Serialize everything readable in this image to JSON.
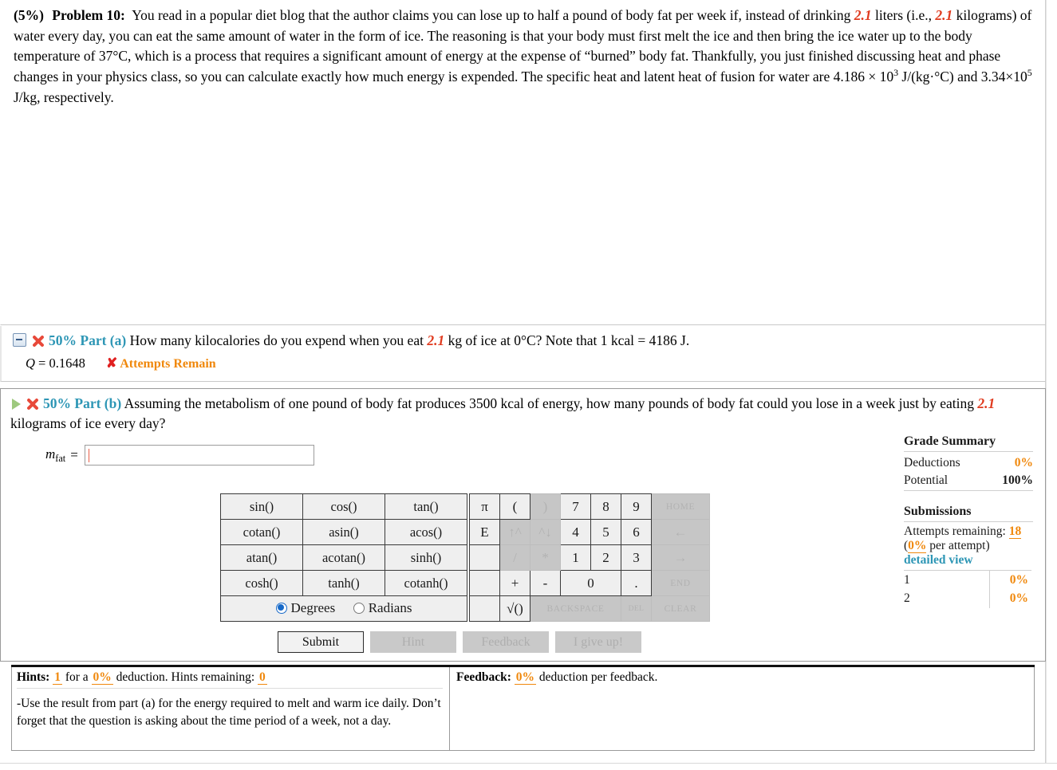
{
  "problem": {
    "weight": "(5%)",
    "label": "Problem 10:",
    "text_parts": {
      "p1": "You read in a popular diet blog that the author claims you can lose up to half a pound of body fat per week if, instead of drinking ",
      "v1": "2.1",
      "p2": " liters (i.e., ",
      "v2": "2.1",
      "p3": " kilograms) of water every day, you can eat the same amount of water in the form of ice. The reasoning is that your body must first melt the ice and then bring the ice water up to the body temperature of 37°C, which is a process that requires a significant amount of energy at the expense of “burned” body fat. Thankfully, you just finished discussing heat and phase changes in your physics class, so you can calculate exactly how much energy is expended. The specific heat and latent heat of fusion for water are 4.186 × 10",
      "exp1": "3",
      "p4": " J/(kg·°C) and 3.34×10",
      "exp2": "5",
      "p5": " J/kg, respectively."
    }
  },
  "part_a": {
    "percent": "50% Part (a)",
    "text_pre": "How many kilocalories do you expend when you eat ",
    "value": "2.1",
    "text_post": " kg of ice at 0°C? Note that 1 kcal = 4186 J.",
    "answer_symbol": "Q",
    "answer_eq": " = 0.1648",
    "xmark": "✘",
    "status": "Attempts Remain"
  },
  "part_b": {
    "percent": "50% Part (b)",
    "text_pre": "Assuming the metabolism of one pound of body fat produces 3500 kcal of energy, how many pounds of body fat could you lose in a week just by eating ",
    "value": "2.1",
    "text_post": " kilograms of ice every day?",
    "answer_label_m": "m",
    "answer_label_sub": "fat",
    "equals": "=",
    "input_value": ""
  },
  "calculator": {
    "functions": [
      [
        "sin()",
        "cos()",
        "tan()"
      ],
      [
        "cotan()",
        "asin()",
        "acos()"
      ],
      [
        "atan()",
        "acotan()",
        "sinh()"
      ],
      [
        "cosh()",
        "tanh()",
        "cotanh()"
      ]
    ],
    "angle_modes": [
      {
        "label": "Degrees",
        "selected": true
      },
      {
        "label": "Radians",
        "selected": false
      }
    ],
    "keypad": [
      [
        {
          "label": "π",
          "disabled": false,
          "size": "normal"
        },
        {
          "label": "(",
          "disabled": false,
          "size": "normal"
        },
        {
          "label": ")",
          "disabled": true,
          "size": "normal"
        },
        {
          "label": "7",
          "disabled": false,
          "size": "normal"
        },
        {
          "label": "8",
          "disabled": false,
          "size": "normal"
        },
        {
          "label": "9",
          "disabled": false,
          "size": "normal"
        },
        {
          "label": "HOME",
          "disabled": true,
          "size": "small"
        }
      ],
      [
        {
          "label": "E",
          "disabled": false,
          "size": "normal"
        },
        {
          "label": "↑^",
          "disabled": true,
          "size": "normal"
        },
        {
          "label": "^↓",
          "disabled": true,
          "size": "normal"
        },
        {
          "label": "4",
          "disabled": false,
          "size": "normal"
        },
        {
          "label": "5",
          "disabled": false,
          "size": "normal"
        },
        {
          "label": "6",
          "disabled": false,
          "size": "normal"
        },
        {
          "label": "←",
          "disabled": true,
          "size": "normal"
        }
      ],
      [
        {
          "label": "",
          "disabled": false,
          "size": "normal"
        },
        {
          "label": "/",
          "disabled": true,
          "size": "normal"
        },
        {
          "label": "*",
          "disabled": true,
          "size": "normal"
        },
        {
          "label": "1",
          "disabled": false,
          "size": "normal"
        },
        {
          "label": "2",
          "disabled": false,
          "size": "normal"
        },
        {
          "label": "3",
          "disabled": false,
          "size": "normal"
        },
        {
          "label": "→",
          "disabled": true,
          "size": "normal"
        }
      ],
      [
        {
          "label": "",
          "disabled": false,
          "size": "normal"
        },
        {
          "label": "+",
          "disabled": false,
          "size": "normal"
        },
        {
          "label": "-",
          "disabled": false,
          "size": "normal"
        },
        {
          "label": "0",
          "disabled": false,
          "size": "normal"
        },
        {
          "label": ".",
          "disabled": false,
          "size": "normal"
        },
        {
          "label": "END",
          "disabled": true,
          "size": "small"
        }
      ],
      [
        {
          "label": "",
          "disabled": false,
          "size": "normal"
        },
        {
          "label": "√()",
          "disabled": false,
          "size": "normal"
        },
        {
          "label": "BACKSPACE",
          "disabled": true,
          "size": "small"
        },
        {
          "label": "DEL",
          "disabled": true,
          "size": "tiny"
        },
        {
          "label": "CLEAR",
          "disabled": true,
          "size": "small"
        }
      ]
    ]
  },
  "buttons": [
    {
      "label": "Submit",
      "disabled": false
    },
    {
      "label": "Hint",
      "disabled": true
    },
    {
      "label": "Feedback",
      "disabled": true
    },
    {
      "label": "I give up!",
      "disabled": true
    }
  ],
  "grade_summary": {
    "title": "Grade Summary",
    "rows": [
      {
        "label": "Deductions",
        "value": "0%",
        "value_style": "amber"
      },
      {
        "label": "Potential",
        "value": "100%",
        "value_style": "bold"
      }
    ],
    "submissions_title": "Submissions",
    "attempts_label": "Attempts remaining:",
    "attempts_value": "18",
    "per_attempt_pct": "0%",
    "per_attempt_text": " per attempt)",
    "per_attempt_open": "(",
    "detailed_view": "detailed view",
    "submission_rows": [
      {
        "num": "1",
        "pct": "0%"
      },
      {
        "num": "2",
        "pct": "0%"
      }
    ]
  },
  "hints": {
    "title": "Hints:",
    "count": "1",
    "for_a": "for a",
    "deduction_pct": "0%",
    "deduction_text": "deduction. Hints remaining:",
    "remaining": "0",
    "body": "-Use the result from part (a) for the energy required to melt and warm ice daily. Don’t forget that the question is asking about the time period of a week, not a day."
  },
  "feedback": {
    "title": "Feedback:",
    "deduction_pct": "0%",
    "deduction_text": "deduction per feedback."
  },
  "colors": {
    "accent_blue": "#2d96b5",
    "amber": "#f0880c",
    "red_var": "#e03a1e",
    "red_x": "#e8493a",
    "green_play": "#9ec97e"
  }
}
